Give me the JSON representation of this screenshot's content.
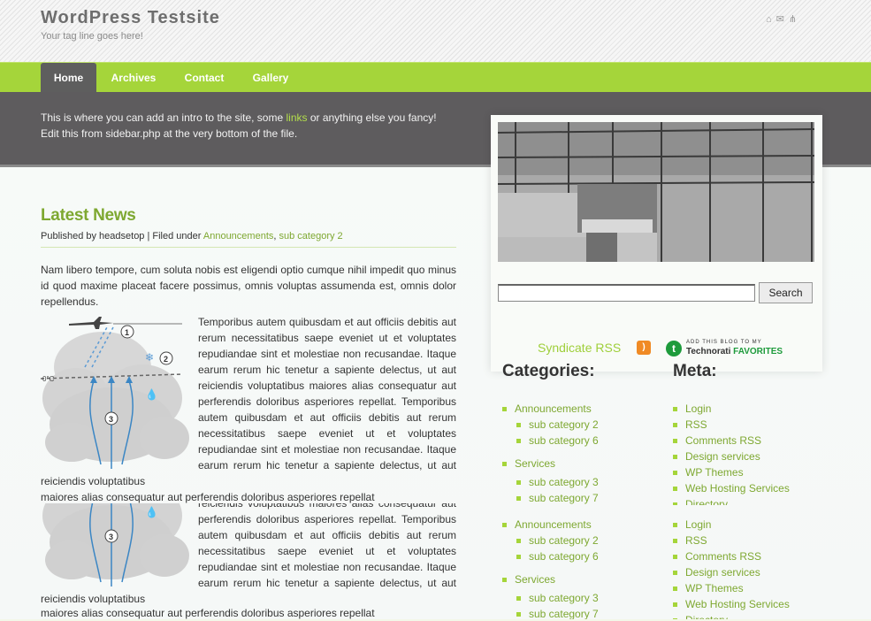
{
  "site": {
    "title": "WordPress Testsite",
    "tagline": "Your tag line goes here!",
    "top_icons": [
      "home-icon",
      "mail-icon",
      "sitemap-icon"
    ]
  },
  "nav": {
    "items": [
      {
        "label": "Home",
        "active": true
      },
      {
        "label": "Archives"
      },
      {
        "label": "Contact"
      },
      {
        "label": "Gallery"
      }
    ]
  },
  "intro": {
    "before_link": "This is where you can add an intro to the site, some ",
    "link": "links",
    "after_link": " or anything else you fancy!",
    "line2": "Edit this from sidebar.php at the very bottom of the file."
  },
  "post": {
    "title": "Latest News",
    "meta_prefix": "Published by headsetop | Filed under ",
    "category1": "Announcements",
    "separator": ", ",
    "category2": "sub category 2",
    "para1": "Nam libero tempore, cum soluta nobis est eligendi optio cumque nihil impedit quo minus id quod maxime placeat facere possimus, omnis voluptas assumenda est, omnis dolor repellendus.",
    "para2": "Temporibus autem quibusdam et aut officiis debitis aut rerum necessitatibus saepe eveniet ut et voluptates repudiandae sint et molestiae non recusandae. Itaque earum rerum hic tenetur a sapiente delectus, ut aut reiciendis voluptatibus maiores alias consequatur aut perferendis doloribus asperiores repellat. Temporibus autem quibusdam et aut officiis debitis aut rerum necessitatibus saepe eveniet ut et voluptates repudiandae sint et molestiae non recusandae. Itaque earum rerum hic tenetur a sapiente delectus, ut aut reiciendis voluptatibus",
    "tail": "maiores alias consequatur aut perferendis doloribus asperiores repellat",
    "diagram_labels": [
      "0°C",
      "1",
      "2",
      "3"
    ]
  },
  "sidebar": {
    "search_button": "Search",
    "search_value": "",
    "syndicate": "Syndicate RSS",
    "technorati_small": "ADD THIS BLOG TO MY",
    "technorati_name": "Technorati",
    "technorati_fav": "FAVORITES",
    "categories_title": "Categories:",
    "meta_title": "Meta:",
    "categories": [
      {
        "label": "Announcements",
        "level": 0
      },
      {
        "label": "sub category 2",
        "level": 1
      },
      {
        "label": "sub category 6",
        "level": 1
      },
      {
        "label": "Services",
        "level": 0
      },
      {
        "label": "sub category 3",
        "level": 1
      },
      {
        "label": "sub category 7",
        "level": 1
      }
    ],
    "meta": [
      "Login",
      "RSS",
      "Comments RSS",
      "Design services",
      "WP Themes",
      "Web Hosting Services",
      "Directory"
    ]
  }
}
